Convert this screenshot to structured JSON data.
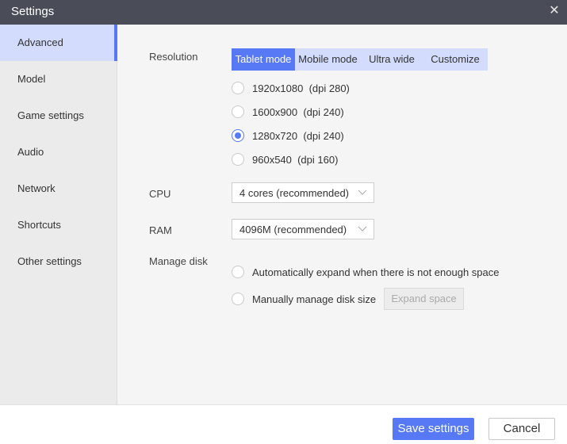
{
  "window": {
    "title": "Settings",
    "close_icon": "close-icon"
  },
  "sidebar": {
    "items": [
      {
        "label": "Advanced",
        "active": true
      },
      {
        "label": "Model"
      },
      {
        "label": "Game settings"
      },
      {
        "label": "Audio"
      },
      {
        "label": "Network"
      },
      {
        "label": "Shortcuts"
      },
      {
        "label": "Other settings"
      }
    ]
  },
  "resolution": {
    "label": "Resolution",
    "tabs": [
      {
        "label": "Tablet mode",
        "active": true
      },
      {
        "label": "Mobile mode"
      },
      {
        "label": "Ultra wide"
      },
      {
        "label": "Customize"
      }
    ],
    "options": [
      {
        "label": "1920x1080  (dpi 280)",
        "checked": false
      },
      {
        "label": "1600x900  (dpi 240)",
        "checked": false
      },
      {
        "label": "1280x720  (dpi 240)",
        "checked": true
      },
      {
        "label": "960x540  (dpi 160)",
        "checked": false
      }
    ]
  },
  "cpu": {
    "label": "CPU",
    "value": "4 cores (recommended)"
  },
  "ram": {
    "label": "RAM",
    "value": "4096M (recommended)"
  },
  "disk": {
    "label": "Manage disk",
    "options": [
      {
        "label": "Automatically expand when there is not enough space",
        "checked": false
      },
      {
        "label": "Manually manage disk size",
        "checked": false
      }
    ],
    "expand_button": "Expand space"
  },
  "footer": {
    "save_label": "Save settings",
    "cancel_label": "Cancel"
  },
  "colors": {
    "accent": "#5779f5",
    "accent_light": "#d3dcfd",
    "titlebar": "#4a4d58"
  }
}
